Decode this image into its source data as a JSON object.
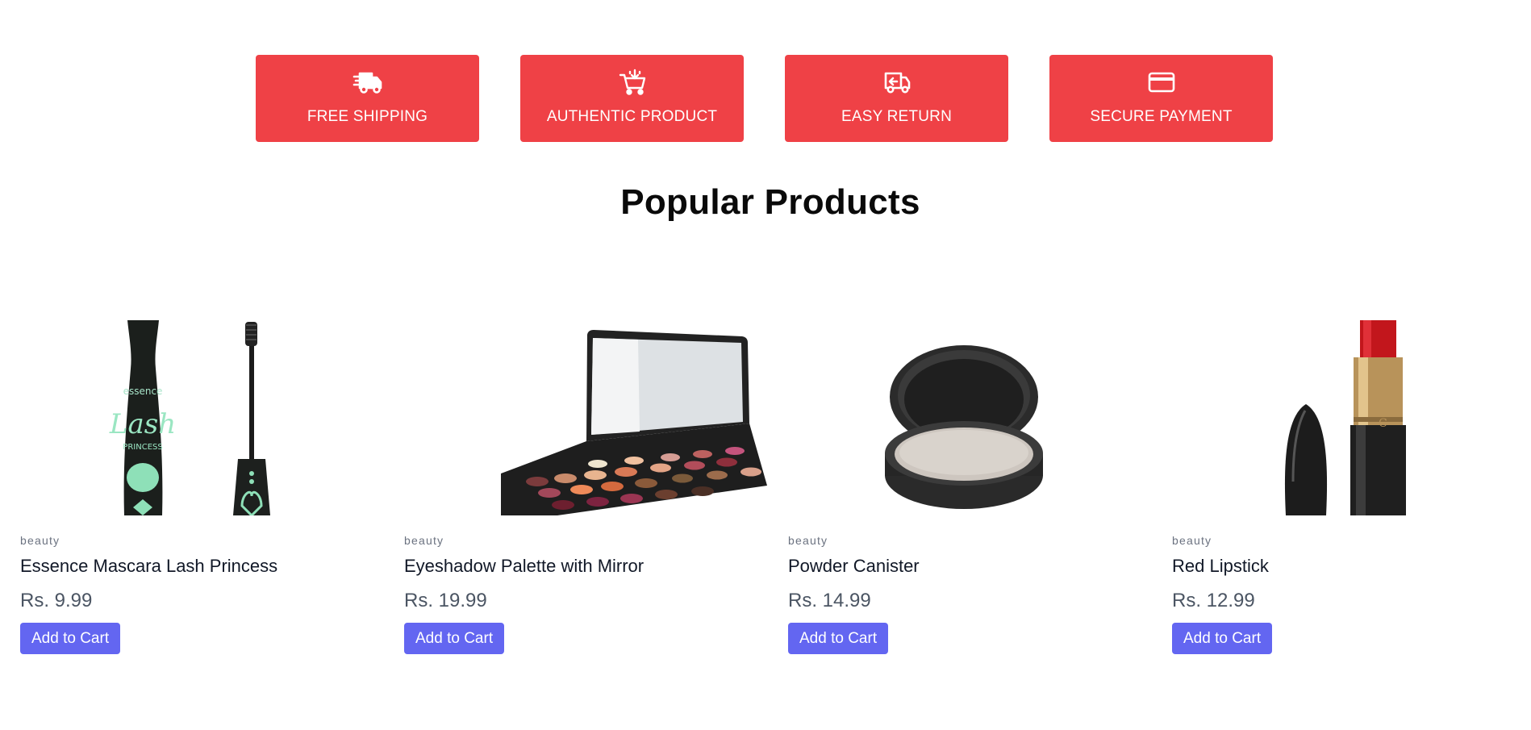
{
  "features": [
    {
      "label": "FREE SHIPPING",
      "icon": "truck-fast-icon"
    },
    {
      "label": "AUTHENTIC PRODUCT",
      "icon": "cart-icon"
    },
    {
      "label": "EASY RETURN",
      "icon": "return-truck-icon"
    },
    {
      "label": "SECURE PAYMENT",
      "icon": "credit-card-icon"
    }
  ],
  "section": {
    "title": "Popular Products"
  },
  "products": [
    {
      "category": "beauty",
      "name": "Essence Mascara Lash Princess",
      "price": "Rs. 9.99",
      "button": "Add to Cart",
      "image": "mascara-image"
    },
    {
      "category": "beauty",
      "name": "Eyeshadow Palette with Mirror",
      "price": "Rs. 19.99",
      "button": "Add to Cart",
      "image": "eyeshadow-palette-image"
    },
    {
      "category": "beauty",
      "name": "Powder Canister",
      "price": "Rs. 14.99",
      "button": "Add to Cart",
      "image": "powder-canister-image"
    },
    {
      "category": "beauty",
      "name": "Red Lipstick",
      "price": "Rs. 12.99",
      "button": "Add to Cart",
      "image": "red-lipstick-image"
    }
  ],
  "colors": {
    "feature_bg": "#ef4146",
    "button_bg": "#6366f1",
    "price": "#4b5563",
    "category": "#6b7280"
  }
}
